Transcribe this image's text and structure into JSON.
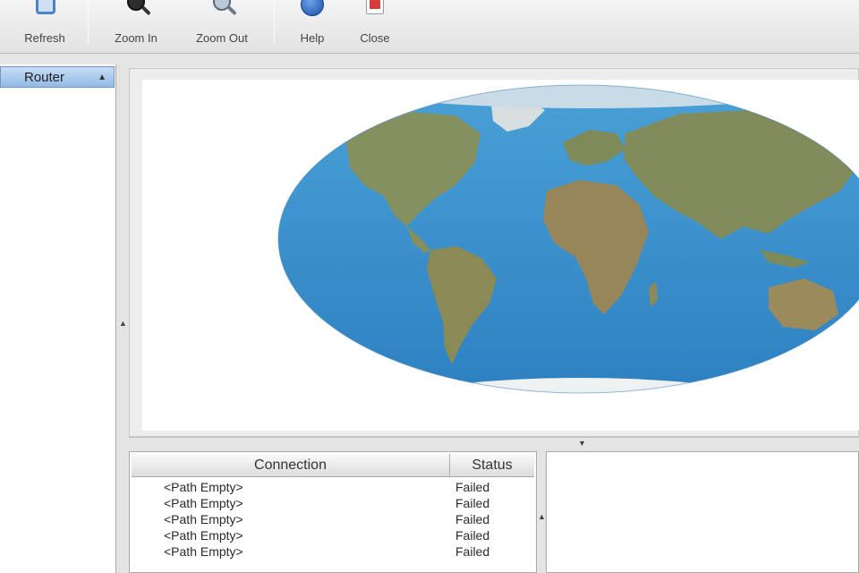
{
  "toolbar": {
    "buttons": [
      {
        "label": "Refresh",
        "icon": "refresh-icon"
      },
      {
        "label": "Zoom In",
        "icon": "zoom-in-icon"
      },
      {
        "label": "Zoom Out",
        "icon": "zoom-out-icon"
      },
      {
        "label": "Help",
        "icon": "help-icon"
      },
      {
        "label": "Close",
        "icon": "close-icon"
      }
    ]
  },
  "left_panel": {
    "column_header": "Router",
    "sort_indicator": "▲"
  },
  "map": {
    "ocean_color": "#2f86c7",
    "land_color": "#7f8c5a",
    "ice_color": "#e4e8ea"
  },
  "connections": {
    "headers": {
      "connection": "Connection",
      "status": "Status"
    },
    "rows": [
      {
        "connection": "<Path Empty>",
        "status": "Failed"
      },
      {
        "connection": "<Path Empty>",
        "status": "Failed"
      },
      {
        "connection": "<Path Empty>",
        "status": "Failed"
      },
      {
        "connection": "<Path Empty>",
        "status": "Failed"
      },
      {
        "connection": "<Path Empty>",
        "status": "Failed"
      }
    ]
  }
}
